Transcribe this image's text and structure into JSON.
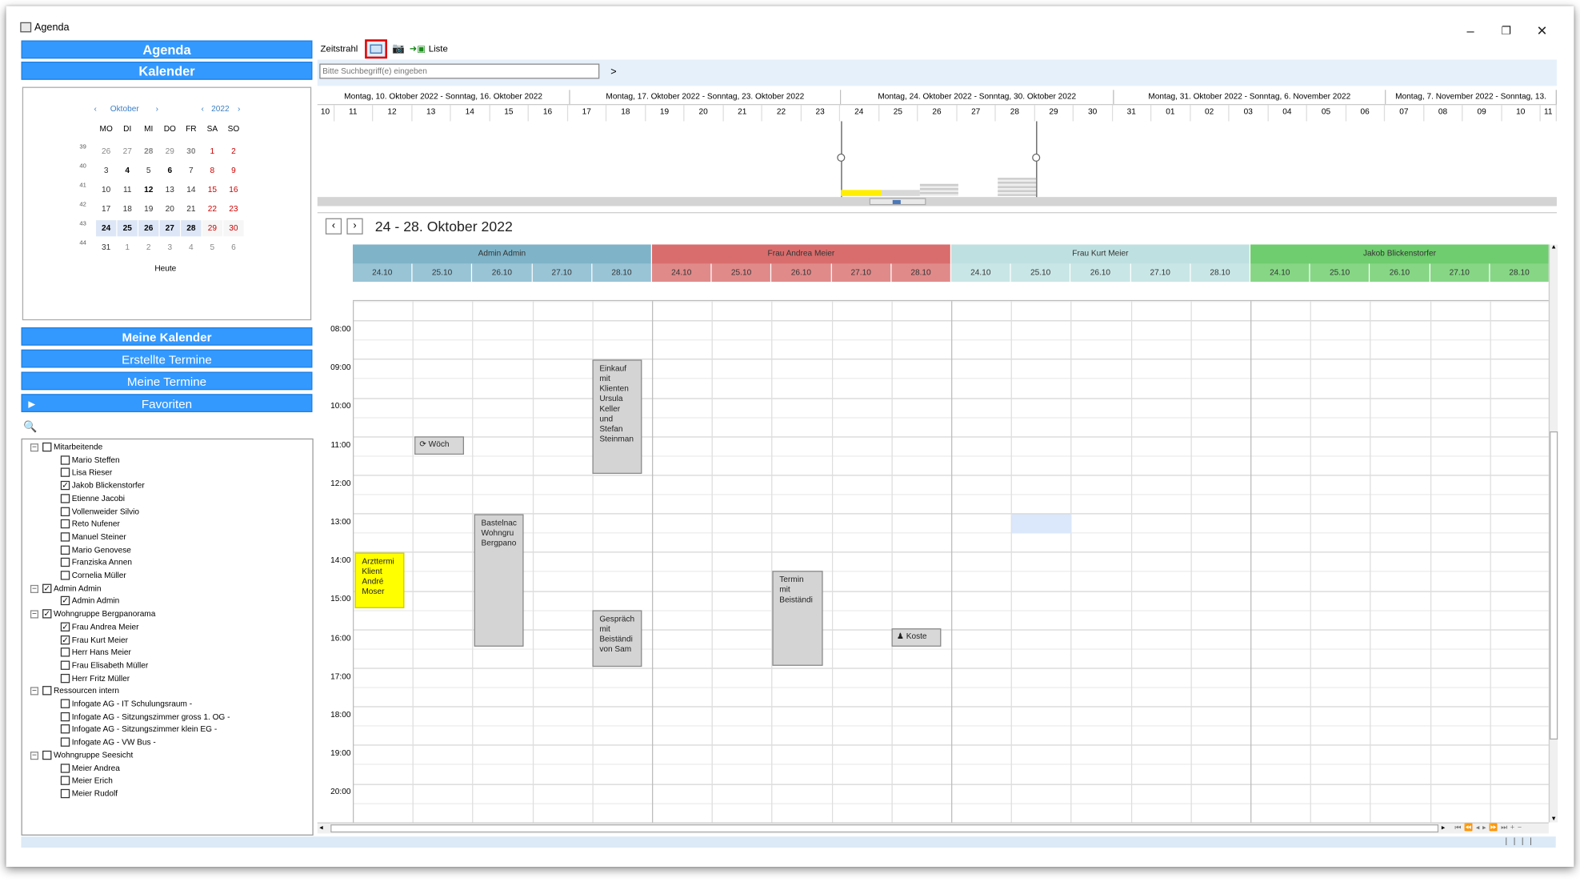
{
  "window": {
    "title": "Agenda",
    "controls": [
      "–",
      "❐",
      "✕"
    ]
  },
  "left": {
    "agenda_label": "Agenda",
    "kalender_label": "Kalender",
    "mini_cal": {
      "month": "Oktober",
      "year": "2022",
      "weekdays": [
        "MO",
        "DI",
        "MI",
        "DO",
        "FR",
        "SA",
        "SO"
      ],
      "weeks": [
        {
          "wk": "39",
          "days": [
            "26",
            "27",
            "28",
            "29",
            "30",
            "1",
            "2"
          ]
        },
        {
          "wk": "40",
          "days": [
            "3",
            "4",
            "5",
            "6",
            "7",
            "8",
            "9"
          ]
        },
        {
          "wk": "41",
          "days": [
            "10",
            "11",
            "12",
            "13",
            "14",
            "15",
            "16"
          ]
        },
        {
          "wk": "42",
          "days": [
            "17",
            "18",
            "19",
            "20",
            "21",
            "22",
            "23"
          ]
        },
        {
          "wk": "43",
          "days": [
            "24",
            "25",
            "26",
            "27",
            "28",
            "29",
            "30"
          ]
        },
        {
          "wk": "44",
          "days": [
            "31",
            "1",
            "2",
            "3",
            "4",
            "5",
            "6"
          ]
        }
      ],
      "today_label": "Heute"
    },
    "meine_kalender": "Meine Kalender",
    "erstellte_termine": "Erstellte Termine",
    "meine_termine": "Meine Termine",
    "favoriten": "Favoriten",
    "tree": [
      {
        "label": "Mitarbeitende",
        "level": 0,
        "checked": false,
        "toggle": "−"
      },
      {
        "label": "Mario Steffen",
        "level": 1,
        "checked": false
      },
      {
        "label": "Lisa Rieser",
        "level": 1,
        "checked": false
      },
      {
        "label": "Jakob Blickenstorfer",
        "level": 1,
        "checked": true
      },
      {
        "label": "Etienne Jacobi",
        "level": 1,
        "checked": false
      },
      {
        "label": "Vollenweider Silvio",
        "level": 1,
        "checked": false
      },
      {
        "label": "Reto Nufener",
        "level": 1,
        "checked": false
      },
      {
        "label": "Manuel Steiner",
        "level": 1,
        "checked": false
      },
      {
        "label": "Mario Genovese",
        "level": 1,
        "checked": false
      },
      {
        "label": "Franziska Annen",
        "level": 1,
        "checked": false
      },
      {
        "label": "Cornelia Müller",
        "level": 1,
        "checked": false
      },
      {
        "label": "Admin Admin",
        "level": 0,
        "checked": true,
        "toggle": "−"
      },
      {
        "label": "Admin Admin",
        "level": 1,
        "checked": true
      },
      {
        "label": "Wohngruppe Bergpanorama",
        "level": 0,
        "checked": true,
        "toggle": "−"
      },
      {
        "label": "Frau Andrea Meier",
        "level": 1,
        "checked": true
      },
      {
        "label": "Frau Kurt Meier",
        "level": 1,
        "checked": true
      },
      {
        "label": "Herr Hans Meier",
        "level": 1,
        "checked": false
      },
      {
        "label": "Frau Elisabeth Müller",
        "level": 1,
        "checked": false
      },
      {
        "label": "Herr Fritz Müller",
        "level": 1,
        "checked": false
      },
      {
        "label": "Ressourcen intern",
        "level": 0,
        "checked": false,
        "toggle": "−"
      },
      {
        "label": "Infogate AG -  IT Schulungsraum -",
        "level": 1,
        "checked": false
      },
      {
        "label": "Infogate AG -  Sitzungszimmer gross 1. OG -",
        "level": 1,
        "checked": false
      },
      {
        "label": "Infogate AG -  Sitzungszimmer klein EG -",
        "level": 1,
        "checked": false
      },
      {
        "label": "Infogate AG -  VW Bus -",
        "level": 1,
        "checked": false
      },
      {
        "label": "Wohngruppe Seesicht",
        "level": 0,
        "checked": false,
        "toggle": "−"
      },
      {
        "label": "Meier Andrea",
        "level": 1,
        "checked": false
      },
      {
        "label": "Meier Erich",
        "level": 1,
        "checked": false
      },
      {
        "label": "Meier Rudolf",
        "level": 1,
        "checked": false
      }
    ]
  },
  "toolbar": {
    "zeitstrahl": "Zeitstrahl",
    "liste": "Liste",
    "search_placeholder": "Bitte Suchbegriff(e) eingeben",
    "go": ">"
  },
  "timeline": {
    "weeks": [
      {
        "label": "Montag, 10. Oktober 2022 - Sonntag, 16. Oktober 2022"
      },
      {
        "label": "Montag, 17. Oktober 2022 - Sonntag, 23. Oktober 2022"
      },
      {
        "label": "Montag, 24. Oktober 2022 - Sonntag, 30. Oktober 2022"
      },
      {
        "label": "Montag, 31. Oktober 2022 - Sonntag, 6. November 2022"
      },
      {
        "label": "Montag, 7. November 2022 - Sonntag, 13."
      }
    ],
    "days": [
      "10",
      "11",
      "12",
      "13",
      "14",
      "15",
      "16",
      "17",
      "18",
      "19",
      "20",
      "21",
      "22",
      "23",
      "24",
      "25",
      "26",
      "27",
      "28",
      "29",
      "30",
      "31",
      "01",
      "02",
      "03",
      "04",
      "05",
      "06",
      "07",
      "08",
      "09",
      "10",
      "11"
    ]
  },
  "week_view": {
    "range_title": "24 - 28. Oktober 2022",
    "resources": [
      {
        "name": "Admin Admin",
        "color": "#7fb4c8",
        "day_color": "#98c4d6"
      },
      {
        "name": "Frau Andrea Meier",
        "color": "#d96d6d",
        "day_color": "#e08a8a"
      },
      {
        "name": "Frau Kurt Meier",
        "color": "#bfe0e0",
        "day_color": "#c9e6e6"
      },
      {
        "name": "Jakob Blickenstorfer",
        "color": "#6fcc6f",
        "day_color": "#86d686"
      }
    ],
    "days": [
      "24.10",
      "25.10",
      "26.10",
      "27.10",
      "28.10"
    ],
    "hours": [
      "08:00",
      "09:00",
      "10:00",
      "11:00",
      "12:00",
      "13:00",
      "14:00",
      "15:00",
      "16:00",
      "17:00",
      "18:00",
      "19:00",
      "20:00"
    ],
    "events": {
      "e1": "Einkauf mit Klienten Ursula Keller und Stefan Steinman",
      "e2": "Wöch",
      "e3": "Bastelnac Wohngru Bergpano",
      "e4": "Arzttermi Klient André Moser",
      "e5": "Termin mit Beiständi",
      "e6": "Gespräch mit Beiständi von Sam",
      "e7": "Koste"
    }
  }
}
